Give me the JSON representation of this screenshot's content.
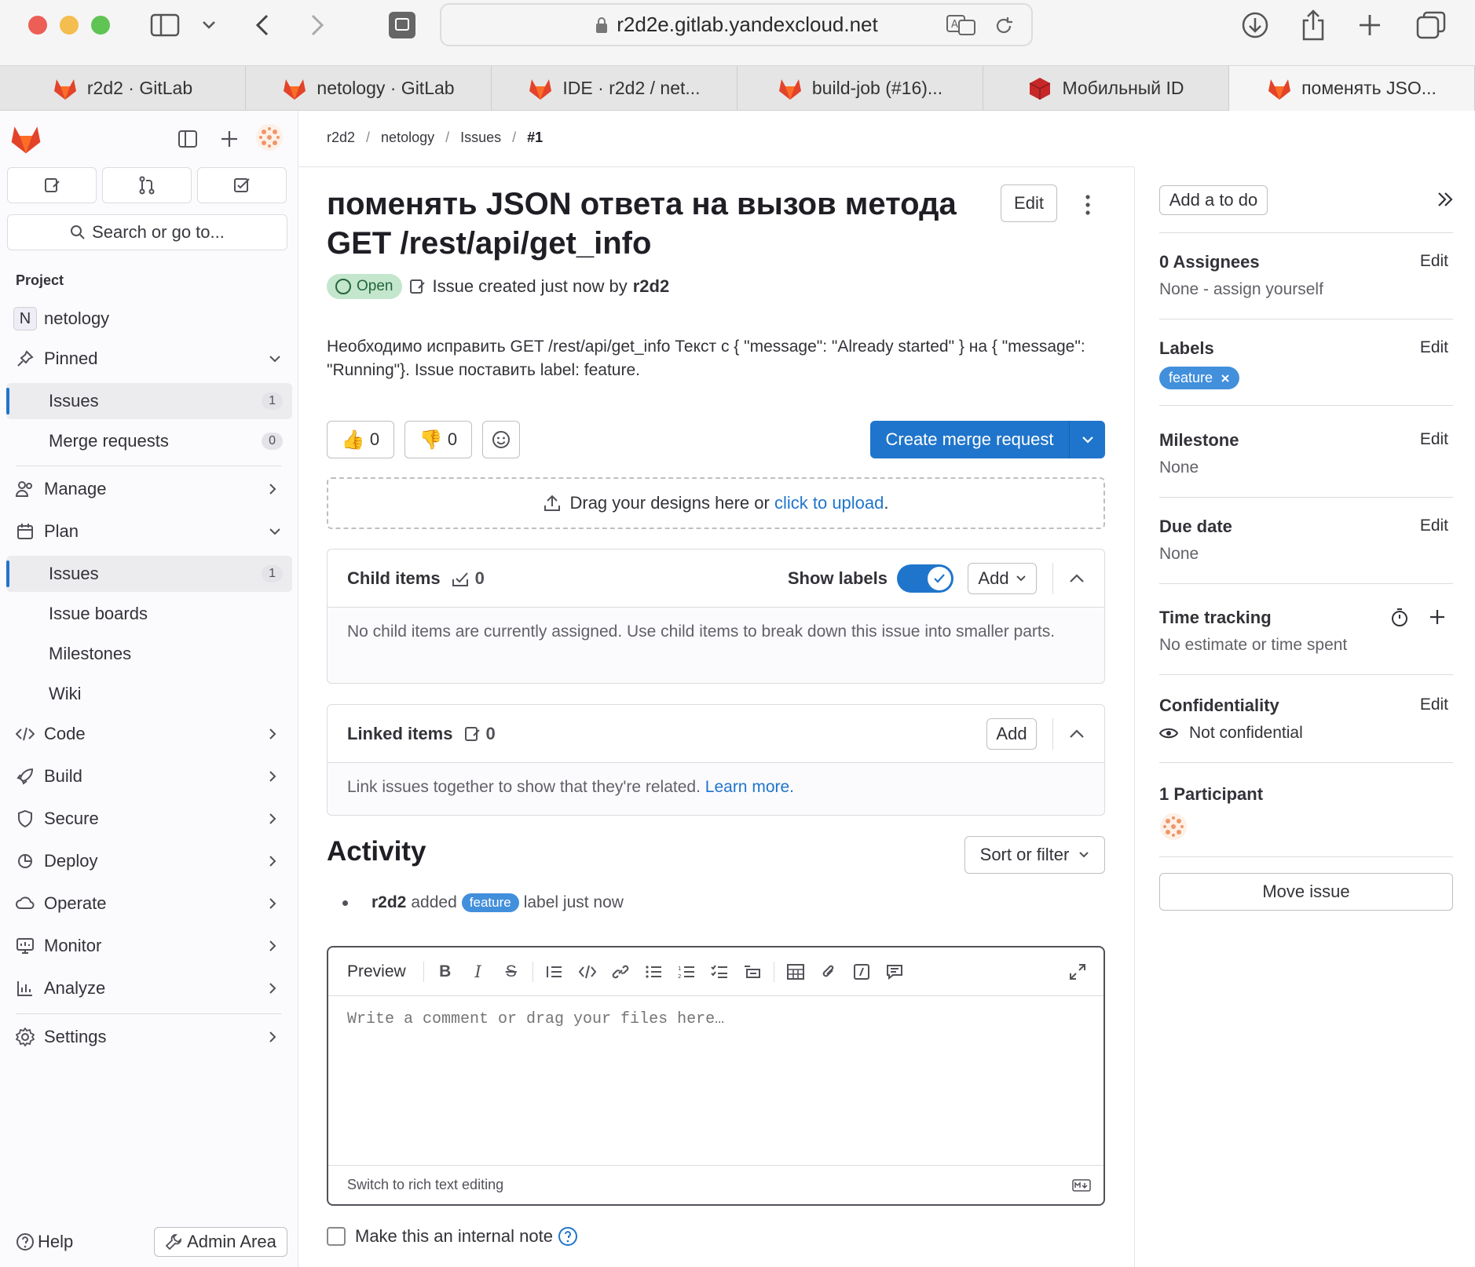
{
  "browser": {
    "url": "r2d2e.gitlab.yandexcloud.net",
    "tabs": [
      {
        "label": "r2d2 · GitLab",
        "active": false
      },
      {
        "label": "netology · GitLab",
        "active": false
      },
      {
        "label": "IDE · r2d2 / net...",
        "active": false
      },
      {
        "label": "build-job (#16)...",
        "active": false
      },
      {
        "label": "Мобильный ID",
        "active": false
      },
      {
        "label": "поменять JSO...",
        "active": true
      }
    ]
  },
  "sidebar": {
    "search": "Search or go to...",
    "section_title": "Project",
    "project_initial": "N",
    "project_name": "netology",
    "pinned": "Pinned",
    "pinned_issues": "Issues",
    "pinned_issues_count": "1",
    "pinned_mr": "Merge requests",
    "pinned_mr_count": "0",
    "manage": "Manage",
    "plan": "Plan",
    "plan_issues": "Issues",
    "plan_issues_count": "1",
    "issue_boards": "Issue boards",
    "milestones": "Milestones",
    "wiki": "Wiki",
    "code": "Code",
    "build": "Build",
    "secure": "Secure",
    "deploy": "Deploy",
    "operate": "Operate",
    "monitor": "Monitor",
    "analyze": "Analyze",
    "settings": "Settings",
    "help": "Help",
    "admin": "Admin Area"
  },
  "breadcrumb": [
    "r2d2",
    "netology",
    "Issues",
    "#1"
  ],
  "issue": {
    "title": "поменять JSON ответа на вызов метода GET /rest/api/get_info",
    "edit": "Edit",
    "status": "Open",
    "meta_prefix": "Issue created just now by",
    "author": "r2d2",
    "description": "Необходимо исправить GET /rest/api/get_info Текст с { \"message\": \"Already started\" } на { \"message\": \"Running\"}. Issue поставить label: feature.",
    "thumbs_up": "0",
    "thumbs_down": "0",
    "create_mr": "Create merge request",
    "upload_text": "Drag your designs here or",
    "upload_link": "click to upload",
    "upload_dot": "."
  },
  "child_items": {
    "title": "Child items",
    "count": "0",
    "show_labels": "Show labels",
    "add": "Add",
    "empty": "No child items are currently assigned. Use child items to break down this issue into smaller parts."
  },
  "linked_items": {
    "title": "Linked items",
    "count": "0",
    "add": "Add",
    "empty": "Link issues together to show that they're related.",
    "learn_more": "Learn more."
  },
  "activity": {
    "title": "Activity",
    "sort": "Sort or filter",
    "note_user": "r2d2",
    "note_action": "added",
    "note_label": "feature",
    "note_suffix": "label just now"
  },
  "editor": {
    "preview": "Preview",
    "placeholder": "Write a comment or drag your files here…",
    "switch": "Switch to rich text editing",
    "internal_note": "Make this an internal note"
  },
  "right_sidebar": {
    "todo": "Add a to do",
    "assignees_title": "0 Assignees",
    "assignees_value": "None - assign yourself",
    "labels_title": "Labels",
    "label": "feature",
    "milestone_title": "Milestone",
    "milestone_value": "None",
    "due_title": "Due date",
    "due_value": "None",
    "time_title": "Time tracking",
    "time_value": "No estimate or time spent",
    "conf_title": "Confidentiality",
    "conf_value": "Not confidential",
    "participants_title": "1 Participant",
    "move_issue": "Move issue",
    "edit": "Edit"
  }
}
